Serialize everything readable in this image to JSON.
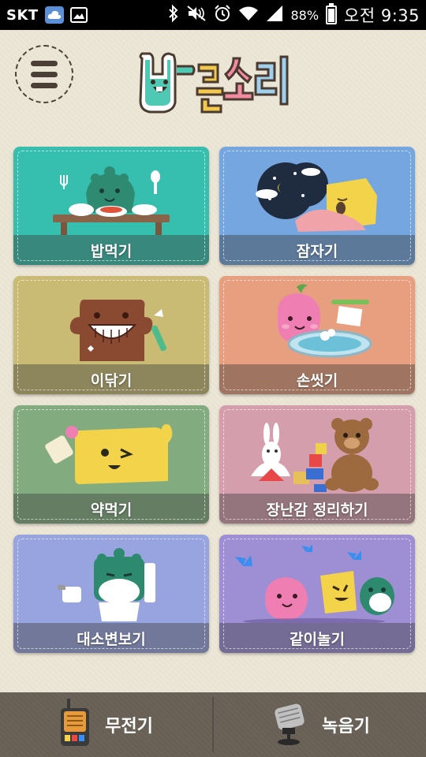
{
  "status_bar": {
    "carrier": "SKT",
    "battery": "88%",
    "time": "오전 9:35",
    "icons": [
      "cloud-icon",
      "gallery-icon",
      "bluetooth-icon",
      "mute-icon",
      "alarm-icon",
      "wifi-icon",
      "signal-icon",
      "battery-icon"
    ]
  },
  "header": {
    "logo_text": "바른소리",
    "menu_icon": "hamburger-icon"
  },
  "cards": [
    {
      "label": "밥먹기",
      "color": "#36bfae"
    },
    {
      "label": "잠자기",
      "color": "#76a6df"
    },
    {
      "label": "이닦기",
      "color": "#c9bb74"
    },
    {
      "label": "손씻기",
      "color": "#e79f7f"
    },
    {
      "label": "약먹기",
      "color": "#82ac80"
    },
    {
      "label": "장난감 정리하기",
      "color": "#d59ead"
    },
    {
      "label": "대소변보기",
      "color": "#98a4df"
    },
    {
      "label": "같이놀기",
      "color": "#9e8fd4"
    }
  ],
  "bottom_bar": {
    "walkie_label": "무전기",
    "recorder_label": "녹음기"
  }
}
